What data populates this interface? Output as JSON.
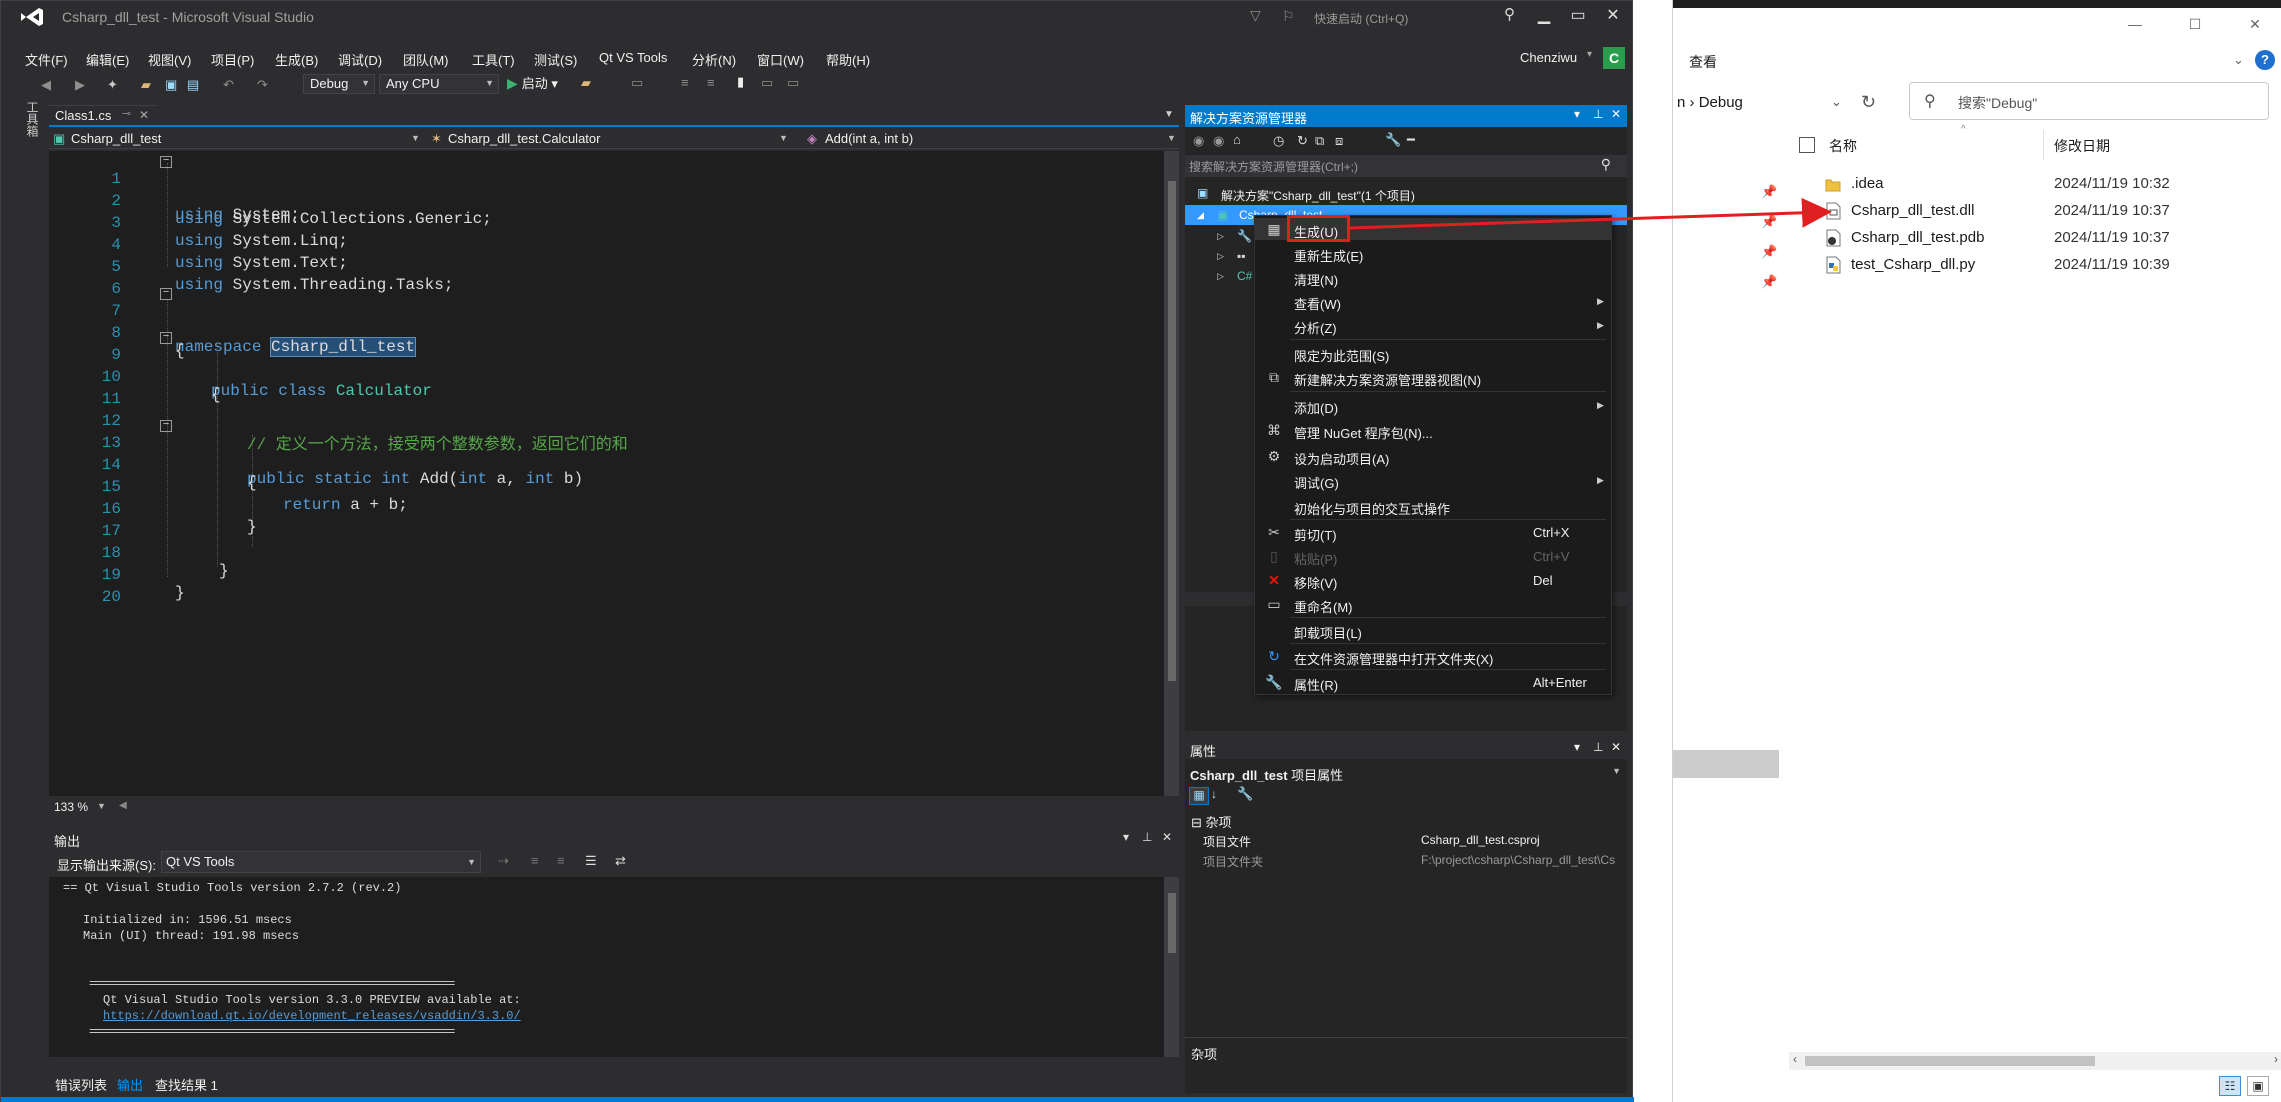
{
  "vs": {
    "title": "Csharp_dll_test - Microsoft Visual Studio",
    "quick_launch": "快速启动 (Ctrl+Q)",
    "menu": [
      "文件(F)",
      "编辑(E)",
      "视图(V)",
      "项目(P)",
      "生成(B)",
      "调试(D)",
      "团队(M)",
      "工具(T)",
      "测试(S)",
      "Qt VS Tools",
      "分析(N)",
      "窗口(W)",
      "帮助(H)"
    ],
    "user": "Chenziwu",
    "avatar": "C",
    "toolbar": {
      "config": "Debug",
      "platform": "Any CPU",
      "start": "启动"
    },
    "left_strip": "工具箱",
    "tab": {
      "name": "Class1.cs"
    },
    "nav": {
      "project": "Csharp_dll_test",
      "class": "Csharp_dll_test.Calculator",
      "member": "Add(int a, int b)"
    },
    "code": {
      "lines": [
        "1",
        "2",
        "3",
        "4",
        "5",
        "6",
        "7",
        "8",
        "9",
        "10",
        "11",
        "12",
        "13",
        "14",
        "15",
        "16",
        "17",
        "18",
        "19",
        "20"
      ],
      "kw_using": "using",
      "u1": " System;",
      "u2": " System.Collections.Generic;",
      "u3": " System.Linq;",
      "u4": " System.Text;",
      "u5": " System.Threading.Tasks;",
      "kw_namespace": "namespace",
      "ns_name": "Csharp_dll_test",
      "brace_open": "{",
      "brace_close": "}",
      "kw_public_class": "public class",
      "class_name": "Calculator",
      "comment": "// 定义一个方法，接受两个整数参数，返回它们的和",
      "kw_public_static_int": "public static int",
      "method_sig_a": " Add(",
      "kw_int": "int",
      "method_sig_b": " a, ",
      "method_sig_c": " b)",
      "kw_return": "return",
      "return_expr": " a + b;"
    },
    "zoom": "133 %",
    "output": {
      "title": "输出",
      "source_label": "显示输出来源(S):",
      "source_value": "Qt VS Tools",
      "lines": [
        "== Qt Visual Studio Tools version 2.7.2 (rev.2)",
        "Initialized in: 1596.51 msecs",
        "Main (UI) thread: 191.98 msecs",
        "================================================================",
        "Qt Visual Studio Tools version 3.3.0 PREVIEW available at:",
        "https://download.qt.io/development_releases/vsaddin/3.3.0/",
        "================================================================"
      ]
    },
    "bottom_tabs": [
      "错误列表",
      "输出",
      "查找结果 1"
    ]
  },
  "solution_explorer": {
    "title": "解决方案资源管理器",
    "search_placeholder": "搜索解决方案资源管理器(Ctrl+;)",
    "solution_node": "解决方案\"Csharp_dll_test\"(1 个项目)",
    "project_node": "Csharp_dll_test"
  },
  "context_menu": [
    {
      "label": "生成(U)",
      "icon": "build-icon",
      "shortcut": "",
      "sub": false,
      "disabled": false,
      "sep_after": false
    },
    {
      "label": "重新生成(E)",
      "icon": "",
      "shortcut": "",
      "sub": false,
      "disabled": false,
      "sep_after": false
    },
    {
      "label": "清理(N)",
      "icon": "",
      "shortcut": "",
      "sub": false,
      "disabled": false,
      "sep_after": false
    },
    {
      "label": "查看(W)",
      "icon": "",
      "shortcut": "",
      "sub": true,
      "disabled": false,
      "sep_after": false
    },
    {
      "label": "分析(Z)",
      "icon": "",
      "shortcut": "",
      "sub": true,
      "disabled": false,
      "sep_after": true
    },
    {
      "label": "限定为此范围(S)",
      "icon": "",
      "shortcut": "",
      "sub": false,
      "disabled": false,
      "sep_after": false
    },
    {
      "label": "新建解决方案资源管理器视图(N)",
      "icon": "new-view-icon",
      "shortcut": "",
      "sub": false,
      "disabled": false,
      "sep_after": true
    },
    {
      "label": "添加(D)",
      "icon": "",
      "shortcut": "",
      "sub": true,
      "disabled": false,
      "sep_after": false
    },
    {
      "label": "管理 NuGet 程序包(N)...",
      "icon": "nuget-icon",
      "shortcut": "",
      "sub": false,
      "disabled": false,
      "sep_after": false
    },
    {
      "label": "设为启动项目(A)",
      "icon": "gear-icon",
      "shortcut": "",
      "sub": false,
      "disabled": false,
      "sep_after": false
    },
    {
      "label": "调试(G)",
      "icon": "",
      "shortcut": "",
      "sub": true,
      "disabled": false,
      "sep_after": false
    },
    {
      "label": "初始化与项目的交互式操作",
      "icon": "",
      "shortcut": "",
      "sub": false,
      "disabled": false,
      "sep_after": true
    },
    {
      "label": "剪切(T)",
      "icon": "scissors-icon",
      "shortcut": "Ctrl+X",
      "sub": false,
      "disabled": false,
      "sep_after": false
    },
    {
      "label": "粘贴(P)",
      "icon": "paste-icon",
      "shortcut": "Ctrl+V",
      "sub": false,
      "disabled": true,
      "sep_after": false
    },
    {
      "label": "移除(V)",
      "icon": "remove-icon",
      "shortcut": "Del",
      "sub": false,
      "disabled": false,
      "sep_after": false
    },
    {
      "label": "重命名(M)",
      "icon": "rename-icon",
      "shortcut": "",
      "sub": false,
      "disabled": false,
      "sep_after": true
    },
    {
      "label": "卸载项目(L)",
      "icon": "",
      "shortcut": "",
      "sub": false,
      "disabled": false,
      "sep_after": true
    },
    {
      "label": "在文件资源管理器中打开文件夹(X)",
      "icon": "refresh-folder-icon",
      "shortcut": "",
      "sub": false,
      "disabled": false,
      "sep_after": true
    },
    {
      "label": "属性(R)",
      "icon": "wrench-icon",
      "shortcut": "Alt+Enter",
      "sub": false,
      "disabled": false,
      "sep_after": false
    }
  ],
  "properties": {
    "title": "属性",
    "object": "Csharp_dll_test",
    "object_type": "项目属性",
    "category": "杂项",
    "rows": [
      {
        "name": "项目文件",
        "value": "Csharp_dll_test.csproj",
        "dim": false
      },
      {
        "name": "项目文件夹",
        "value": "F:\\project\\csharp\\Csharp_dll_test\\Cs",
        "dim": true
      }
    ],
    "desc_title": "杂项"
  },
  "explorer": {
    "menu_view": "查看",
    "address": "Debug",
    "address_prefix": "n",
    "search_placeholder": "搜索\"Debug\"",
    "col_name": "名称",
    "col_date": "修改日期",
    "files": [
      {
        "name": ".idea",
        "date": "2024/11/19 10:32",
        "icon": "folder-icon"
      },
      {
        "name": "Csharp_dll_test.dll",
        "date": "2024/11/19 10:37",
        "icon": "dll-file-icon"
      },
      {
        "name": "Csharp_dll_test.pdb",
        "date": "2024/11/19 10:37",
        "icon": "pdb-file-icon"
      },
      {
        "name": "test_Csharp_dll.py",
        "date": "2024/11/19 10:39",
        "icon": "python-file-icon"
      }
    ]
  },
  "colors": {
    "vs_accent": "#007acc",
    "annotation": "#e02020",
    "keyword": "#569cd6",
    "type": "#4ec9b0",
    "comment": "#57a64a"
  }
}
